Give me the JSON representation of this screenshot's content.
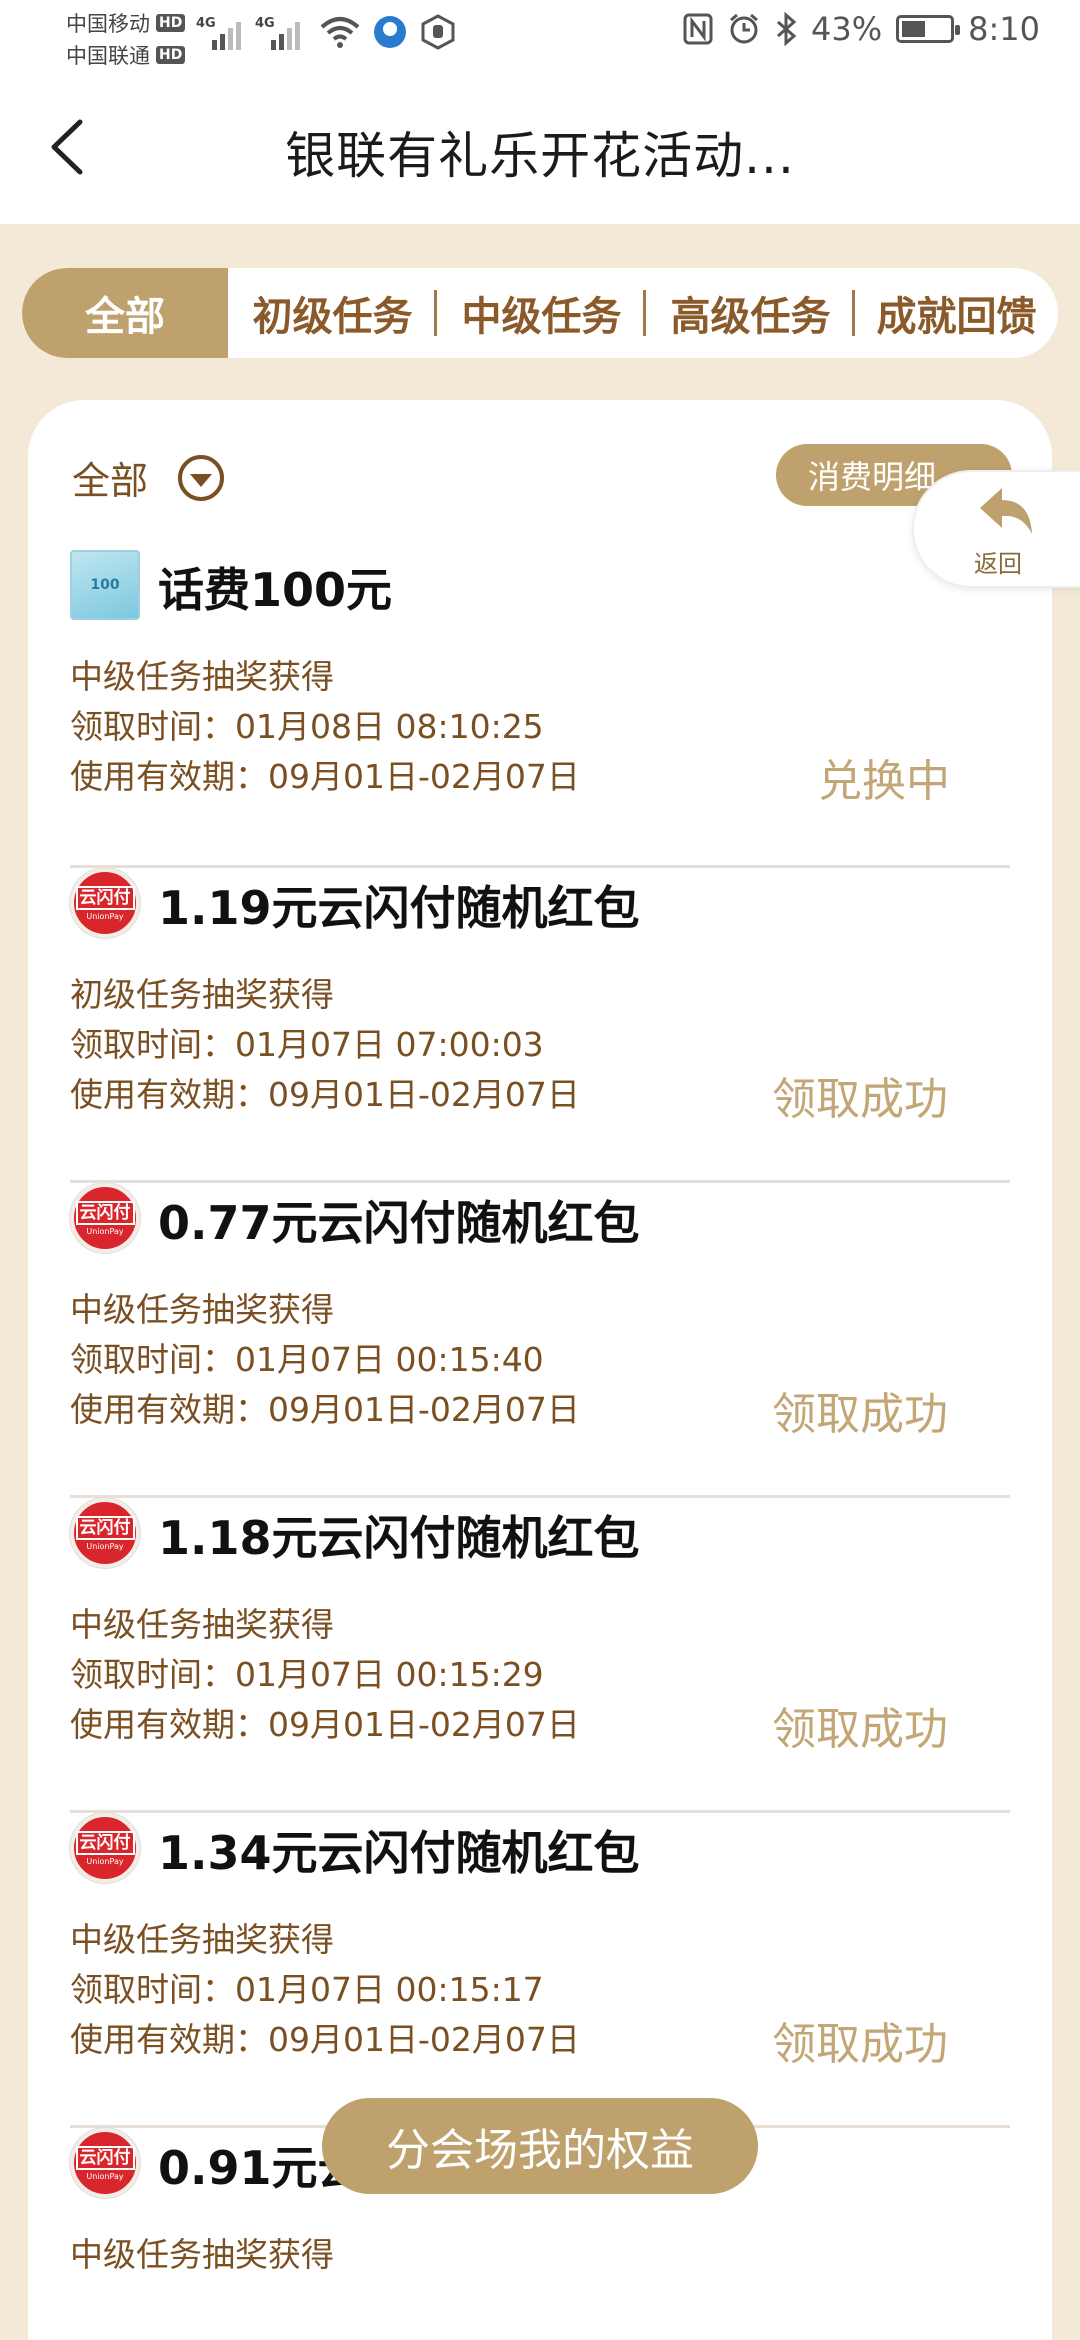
{
  "status_bar": {
    "carrier1": "中国移动",
    "carrier2": "中国联通",
    "hd": "HD",
    "network": "4G",
    "battery": "43%",
    "time": "8:10"
  },
  "header": {
    "title": "银联有礼乐开花活动..."
  },
  "tabs": [
    {
      "label": "全部"
    },
    {
      "label": "初级任务"
    },
    {
      "label": "中级任务"
    },
    {
      "label": "高级任务"
    },
    {
      "label": "成就回馈"
    }
  ],
  "filter": {
    "label": "全部"
  },
  "detail_button": "消费明细",
  "float_return": "返回",
  "items": [
    {
      "title": "话费100元",
      "source": "中级任务抽奖获得",
      "time": "领取时间：01月08日 08:10:25",
      "valid": "使用有效期：09月01日-02月07日",
      "status": "兑换中",
      "icon_text": "100"
    },
    {
      "title": "1.19元云闪付随机红包",
      "source": "初级任务抽奖获得",
      "time": "领取时间：01月07日 07:00:03",
      "valid": "使用有效期：09月01日-02月07日",
      "status": "领取成功",
      "icon_text": "云闪付",
      "icon_sub": "UnionPay"
    },
    {
      "title": "0.77元云闪付随机红包",
      "source": "中级任务抽奖获得",
      "time": "领取时间：01月07日 00:15:40",
      "valid": "使用有效期：09月01日-02月07日",
      "status": "领取成功",
      "icon_text": "云闪付",
      "icon_sub": "UnionPay"
    },
    {
      "title": "1.18元云闪付随机红包",
      "source": "中级任务抽奖获得",
      "time": "领取时间：01月07日 00:15:29",
      "valid": "使用有效期：09月01日-02月07日",
      "status": "领取成功",
      "icon_text": "云闪付",
      "icon_sub": "UnionPay"
    },
    {
      "title": "1.34元云闪付随机红包",
      "source": "中级任务抽奖获得",
      "time": "领取时间：01月07日 00:15:17",
      "valid": "使用有效期：09月01日-02月07日",
      "status": "领取成功",
      "icon_text": "云闪付",
      "icon_sub": "UnionPay"
    },
    {
      "title": "0.91元云",
      "source": "中级任务抽奖获得",
      "icon_text": "云闪付",
      "icon_sub": "UnionPay"
    }
  ],
  "bottom_button": "分会场我的权益"
}
